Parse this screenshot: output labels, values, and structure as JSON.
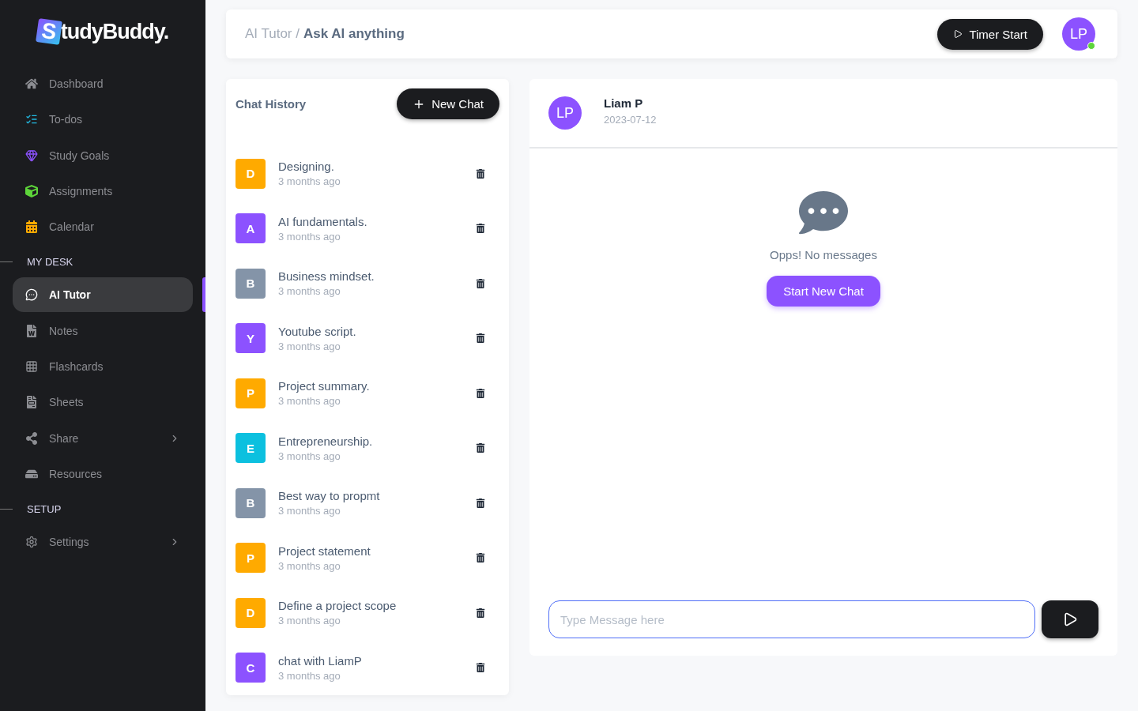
{
  "logo": {
    "badge": "S",
    "text": "tudyBuddy."
  },
  "sidebar": {
    "groups": [
      {
        "items": [
          {
            "label": "Dashboard",
            "selected": false,
            "expandable": false
          },
          {
            "label": "To-dos",
            "selected": false,
            "expandable": false
          },
          {
            "label": "Study Goals",
            "selected": false,
            "expandable": false
          },
          {
            "label": "Assignments",
            "selected": false,
            "expandable": false
          },
          {
            "label": "Calendar",
            "selected": false,
            "expandable": false
          }
        ]
      },
      {
        "title": "MY DESK",
        "items": [
          {
            "label": "AI Tutor",
            "selected": true,
            "expandable": false
          },
          {
            "label": "Notes",
            "selected": false,
            "expandable": false
          },
          {
            "label": "Flashcards",
            "selected": false,
            "expandable": false
          },
          {
            "label": "Sheets",
            "selected": false,
            "expandable": false
          },
          {
            "label": "Share",
            "selected": false,
            "expandable": true
          },
          {
            "label": "Resources",
            "selected": false,
            "expandable": false
          }
        ]
      },
      {
        "title": "SETUP",
        "items": [
          {
            "label": "Settings",
            "selected": false,
            "expandable": true
          }
        ]
      }
    ]
  },
  "header": {
    "breadcrumb_parent": "AI Tutor /",
    "breadcrumb_current": "Ask AI anything",
    "timer_button": "Timer Start",
    "avatar": "LP",
    "online": true
  },
  "chat_history": {
    "title": "Chat History",
    "new_button": "New Chat",
    "chats": [
      {
        "letter": "D",
        "title": "Designing.",
        "time": "3 months ago",
        "color": "#ffaa00"
      },
      {
        "letter": "A",
        "title": "AI fundamentals.",
        "time": "3 months ago",
        "color": "#8c52ff"
      },
      {
        "letter": "B",
        "title": "Business mindset.",
        "time": "3 months ago",
        "color": "#8494a8"
      },
      {
        "letter": "Y",
        "title": "Youtube script.",
        "time": "3 months ago",
        "color": "#8c52ff"
      },
      {
        "letter": "P",
        "title": "Project summary.",
        "time": "3 months ago",
        "color": "#ffaa00"
      },
      {
        "letter": "E",
        "title": "Entrepreneurship.",
        "time": "3 months ago",
        "color": "#0cc0df"
      },
      {
        "letter": "B",
        "title": "Best way to propmt",
        "time": "3 months ago",
        "color": "#8494a8"
      },
      {
        "letter": "P",
        "title": "Project statement",
        "time": "3 months ago",
        "color": "#ffaa00"
      },
      {
        "letter": "D",
        "title": "Define a project scope",
        "time": "3 months ago",
        "color": "#ffaa00"
      },
      {
        "letter": "C",
        "title": "chat with LiamP",
        "time": "3 months ago",
        "color": "#8c52ff"
      }
    ]
  },
  "conversation": {
    "avatar": "LP",
    "name": "Liam P",
    "date": "2023-07-12",
    "empty_text": "Opps! No messages",
    "start_button": "Start New Chat",
    "composer": {
      "placeholder": "Type Message here"
    }
  }
}
